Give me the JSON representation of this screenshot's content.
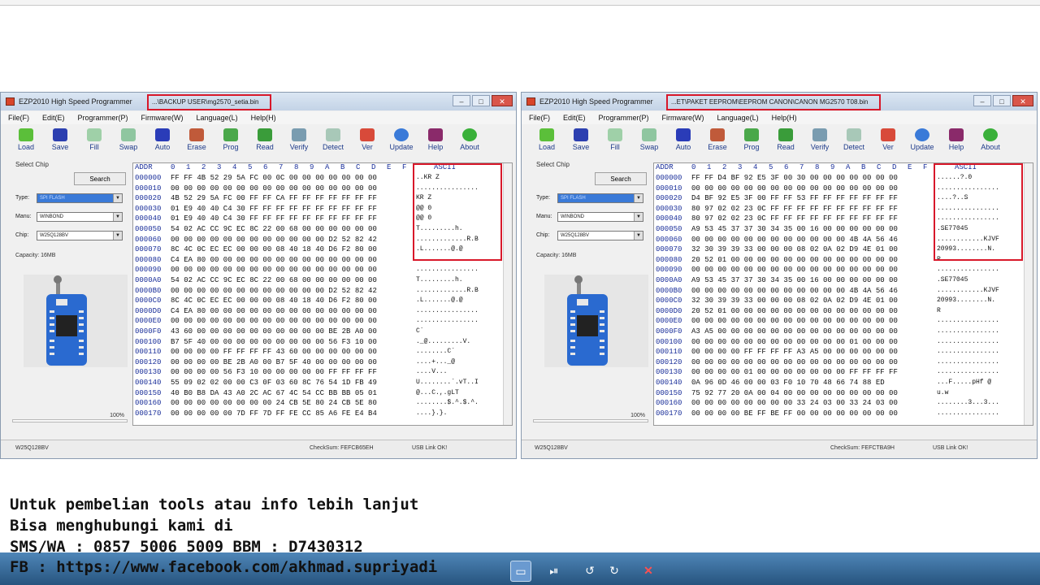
{
  "windows": [
    {
      "id": "left",
      "title": "EZP2010 High Speed Programmer",
      "file_path": "...\\BACKUP USER\\mg2570_setia.bin",
      "menu": [
        "File(F)",
        "Edit(E)",
        "Programmer(P)",
        "Firmware(W)",
        "Language(L)",
        "Help(H)"
      ],
      "tools": [
        "Load",
        "Save",
        "Fill",
        "Swap",
        "Auto",
        "Erase",
        "Prog",
        "Read",
        "Verify",
        "Detect",
        "Ver",
        "Update",
        "Help",
        "About"
      ],
      "select_chip_label": "Select Chip",
      "search_label": "Search",
      "type_label": "Type:",
      "type_value": "SPI FLASH",
      "manu_label": "Manu:",
      "manu_value": "WINBOND",
      "chip_label": "Chip:",
      "chip_value": "W25Q128BV",
      "capacity": "Capacity: 16MB",
      "progress_label": "100%",
      "hex_header": [
        "ADDR",
        "0",
        "1",
        "2",
        "3",
        "4",
        "5",
        "6",
        "7",
        "8",
        "9",
        "A",
        "B",
        "C",
        "D",
        "E",
        "F",
        "ASCII"
      ],
      "rows": [
        {
          "addr": "000000",
          "hex": "FF FF 4B 52 29 5A FC 00 0C 00 00 00 00 00 00 00",
          "ascii": "..KR Z"
        },
        {
          "addr": "000010",
          "hex": "00 00 00 00 00 00 00 00 00 00 00 00 00 00 00 00",
          "ascii": "................"
        },
        {
          "addr": "000020",
          "hex": "4B 52 29 5A FC 00 FF FF CA FF FF FF FF FF FF FF",
          "ascii": "KR Z"
        },
        {
          "addr": "000030",
          "hex": "01 E9 40 40 C4 30 FF FF FF FF FF FF FF FF FF FF",
          "ascii": " @@ 0"
        },
        {
          "addr": "000040",
          "hex": "01 E9 40 40 C4 30 FF FF FF FF FF FF FF FF FF FF",
          "ascii": " @@ 0"
        },
        {
          "addr": "000050",
          "hex": "54 02 AC CC 9C EC 8C 22 00 68 00 00 00 00 00 00",
          "ascii": "T.........h."
        },
        {
          "addr": "000060",
          "hex": "00 00 00 00 00 00 00 00 00 00 00 00 D2 52 82 42",
          "ascii": ".............R.B"
        },
        {
          "addr": "000070",
          "hex": "8C 4C 0C EC EC 00 00 00 08 40 18 40 D6 F2 80 00",
          "ascii": ".L.......@.@"
        },
        {
          "addr": "000080",
          "hex": "C4 EA 80 00 00 00 00 00 00 00 00 00 00 00 00 00",
          "ascii": "................"
        },
        {
          "addr": "000090",
          "hex": "00 00 00 00 00 00 00 00 00 00 00 00 00 00 00 00",
          "ascii": "................"
        },
        {
          "addr": "0000A0",
          "hex": "54 02 AC CC 9C EC 8C 22 00 68 00 00 00 00 00 00",
          "ascii": "T.........h."
        },
        {
          "addr": "0000B0",
          "hex": "00 00 00 00 00 00 00 00 00 00 00 00 D2 52 82 42",
          "ascii": ".............R.B"
        },
        {
          "addr": "0000C0",
          "hex": "8C 4C 0C EC EC 00 00 00 08 40 18 40 D6 F2 80 00",
          "ascii": ".L.......@.@"
        },
        {
          "addr": "0000D0",
          "hex": "C4 EA 80 00 00 00 00 00 00 00 00 00 00 00 00 00",
          "ascii": "................"
        },
        {
          "addr": "0000E0",
          "hex": "00 00 00 00 00 00 00 00 00 00 00 00 00 00 00 00",
          "ascii": "................"
        },
        {
          "addr": "0000F0",
          "hex": "43 60 00 00 00 00 00 00 00 00 00 00 BE 2B A0 00",
          "ascii": "C`"
        },
        {
          "addr": "000100",
          "hex": "B7 5F 40 00 00 00 00 00 00 00 00 00 56 F3 10 00",
          "ascii": "._@.........V."
        },
        {
          "addr": "000110",
          "hex": "00 00 00 00 FF FF FF FF 43 60 00 00 00 00 00 00",
          "ascii": "........C`"
        },
        {
          "addr": "000120",
          "hex": "00 00 00 00 BE 2B A0 00 B7 5F 40 00 00 00 00 00",
          "ascii": "....+..._@"
        },
        {
          "addr": "000130",
          "hex": "00 00 00 00 56 F3 10 00 00 00 00 00 FF FF FF FF",
          "ascii": "....V..."
        },
        {
          "addr": "000140",
          "hex": "55 09 02 02 00 00 C3 0F 03 60 8C 76 54 1D FB 49",
          "ascii": "U........`.vT..I"
        },
        {
          "addr": "000150",
          "hex": "40 B0 B8 DA 43 A0 2C AC 67 4C 54 CC BB BB 05 01",
          "ascii": "@...C.,.gLT"
        },
        {
          "addr": "000160",
          "hex": "00 00 00 00 00 00 00 00 24 CB 5E 80 24 CB 5E 80",
          "ascii": "........$.^.$.^."
        },
        {
          "addr": "000170",
          "hex": "00 00 00 00 00 7D FF 7D FF FE CC 85 A6 FE E4 B4",
          "ascii": "....}.}."
        }
      ],
      "status_chip": "W25Q128BV",
      "status_checksum": "CheckSum: FEFCB65EH",
      "status_usb": "USB Link OK!"
    },
    {
      "id": "right",
      "title": "EZP2010 High Speed Programmer",
      "file_path": "...ET\\PAKET EEPROM\\EEPROM CANON\\CANON MG2570 T08.bin",
      "menu": [
        "File(F)",
        "Edit(E)",
        "Programmer(P)",
        "Firmware(W)",
        "Language(L)",
        "Help(H)"
      ],
      "tools": [
        "Load",
        "Save",
        "Fill",
        "Swap",
        "Auto",
        "Erase",
        "Prog",
        "Read",
        "Verify",
        "Detect",
        "Ver",
        "Update",
        "Help",
        "About"
      ],
      "select_chip_label": "Select Chip",
      "search_label": "Search",
      "type_label": "Type:",
      "type_value": "SPI FLASH",
      "manu_label": "Manu:",
      "manu_value": "WINBOND",
      "chip_label": "Chip:",
      "chip_value": "W25Q128BV",
      "capacity": "Capacity: 16MB",
      "progress_label": "100%",
      "hex_header": [
        "ADDR",
        "0",
        "1",
        "2",
        "3",
        "4",
        "5",
        "6",
        "7",
        "8",
        "9",
        "A",
        "B",
        "C",
        "D",
        "E",
        "F",
        "ASCII"
      ],
      "rows": [
        {
          "addr": "000000",
          "hex": "FF FF D4 BF 92 E5 3F 00 30 00 00 00 00 00 00 00",
          "ascii": "......?.0"
        },
        {
          "addr": "000010",
          "hex": "00 00 00 00 00 00 00 00 00 00 00 00 00 00 00 00",
          "ascii": "................"
        },
        {
          "addr": "000020",
          "hex": "D4 BF 92 E5 3F 00 FF FF 53 FF FF FF FF FF FF FF",
          "ascii": "....?..S"
        },
        {
          "addr": "000030",
          "hex": "80 97 02 02 23 0C FF FF FF FF FF FF FF FF FF FF",
          "ascii": "................"
        },
        {
          "addr": "000040",
          "hex": "80 97 02 02 23 0C FF FF FF FF FF FF FF FF FF FF",
          "ascii": "................"
        },
        {
          "addr": "000050",
          "hex": "A9 53 45 37 37 30 34 35 00 16 00 00 00 00 00 00",
          "ascii": ".SE77045"
        },
        {
          "addr": "000060",
          "hex": "00 00 00 00 00 00 00 00 00 00 00 00 4B 4A 56 46",
          "ascii": "............KJVF"
        },
        {
          "addr": "000070",
          "hex": "32 30 39 39 33 00 00 00 08 02 0A 02 D9 4E 01 00",
          "ascii": "20993........N."
        },
        {
          "addr": "000080",
          "hex": "20 52 01 00 00 00 00 00 00 00 00 00 00 00 00 00",
          "ascii": " R"
        },
        {
          "addr": "000090",
          "hex": "00 00 00 00 00 00 00 00 00 00 00 00 00 00 00 00",
          "ascii": "................"
        },
        {
          "addr": "0000A0",
          "hex": "A9 53 45 37 37 30 34 35 00 16 00 00 00 00 00 00",
          "ascii": ".SE77045"
        },
        {
          "addr": "0000B0",
          "hex": "00 00 00 00 00 00 00 00 00 00 00 00 4B 4A 56 46",
          "ascii": "............KJVF"
        },
        {
          "addr": "0000C0",
          "hex": "32 30 39 39 33 00 00 00 08 02 0A 02 D9 4E 01 00",
          "ascii": "20993........N."
        },
        {
          "addr": "0000D0",
          "hex": "20 52 01 00 00 00 00 00 00 00 00 00 00 00 00 00",
          "ascii": " R"
        },
        {
          "addr": "0000E0",
          "hex": "00 00 00 00 00 00 00 00 00 00 00 00 00 00 00 00",
          "ascii": "................"
        },
        {
          "addr": "0000F0",
          "hex": "A3 A5 00 00 00 00 00 00 00 00 00 00 00 00 00 00",
          "ascii": "................"
        },
        {
          "addr": "000100",
          "hex": "00 00 00 00 00 00 00 00 00 00 00 00 01 00 00 00",
          "ascii": "................"
        },
        {
          "addr": "000110",
          "hex": "00 00 00 00 FF FF FF FF A3 A5 00 00 00 00 00 00",
          "ascii": "................"
        },
        {
          "addr": "000120",
          "hex": "00 00 00 00 00 00 00 00 00 00 00 00 00 00 00 00",
          "ascii": "................"
        },
        {
          "addr": "000130",
          "hex": "00 00 00 00 01 00 00 00 00 00 00 00 FF FF FF FF",
          "ascii": "................"
        },
        {
          "addr": "000140",
          "hex": "0A 96 0D 46 00 00 03 F0 10 70 48 66 74 88 ED",
          "ascii": "...F.....pHf @"
        },
        {
          "addr": "000150",
          "hex": "75 92 77 20 0A 00 04 00 00 00 00 00 00 00 00 00",
          "ascii": "u.w"
        },
        {
          "addr": "000160",
          "hex": "00 00 00 00 00 00 00 00 33 24 03 00 33 24 03 00",
          "ascii": "........3...3..."
        },
        {
          "addr": "000170",
          "hex": "00 00 00 00 BE FF BE FF 00 00 00 00 00 00 00 00",
          "ascii": "................"
        }
      ],
      "status_chip": "W25Q128BV",
      "status_checksum": "CheckSum: FEFCTBA9H",
      "status_usb": "USB Link OK!"
    }
  ],
  "footer": {
    "line1": "Untuk pembelian tools atau info lebih lanjut",
    "line2": "Bisa menghubungi kami di",
    "line3": "SMS/WA : 0857 5006 5009  BBM : D7430312",
    "line4": "FB : https://www.facebook.com/akhmad.supriyadi"
  },
  "colors": {
    "highlight_red": "#d8182a",
    "addr_blue": "#1a2f9a",
    "taskbar": "#27547e"
  }
}
